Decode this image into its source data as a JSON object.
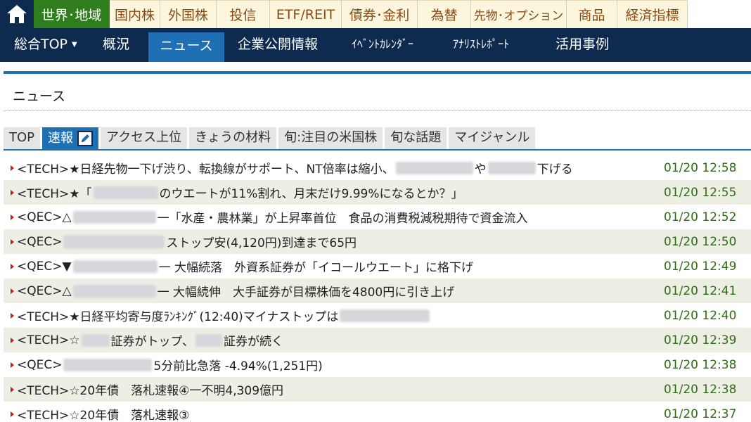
{
  "top_nav": {
    "home_icon": "home-icon",
    "items": [
      {
        "label": "世界･地域",
        "active": true
      },
      {
        "label": "国内株"
      },
      {
        "label": "外国株"
      },
      {
        "label": "投信"
      },
      {
        "label": "ETF/REIT"
      },
      {
        "label": "債券･金利"
      },
      {
        "label": "為替"
      },
      {
        "label": "先物･オプション"
      },
      {
        "label": "商品"
      },
      {
        "label": "経済指標"
      }
    ]
  },
  "sub_nav": {
    "items": [
      {
        "label": "総合TOP",
        "dropdown": true
      },
      {
        "label": "概況"
      },
      {
        "label": "ニュース",
        "active": true
      },
      {
        "label": "企業公開情報"
      },
      {
        "label": "ｲﾍﾞﾝﾄｶﾚﾝﾀﾞｰ"
      },
      {
        "label": "ｱﾅﾘｽﾄﾚﾎﾟｰﾄ"
      },
      {
        "label": "活用事例"
      }
    ]
  },
  "page_title": "ニュース",
  "tabs": [
    {
      "label": "TOP"
    },
    {
      "label": "速報",
      "active": true,
      "icon": "pencil-icon"
    },
    {
      "label": "アクセス上位"
    },
    {
      "label": "きょうの材料"
    },
    {
      "label": "旬:注目の米国株"
    },
    {
      "label": "旬な話題"
    },
    {
      "label": "マイジャンル"
    }
  ],
  "news": [
    {
      "parts": [
        "<TECH>★日経先物一下げ渋り、転換線がサポート、NT倍率は縮小、",
        "",
        "や",
        "",
        "下げる"
      ],
      "time": "01/20 12:58"
    },
    {
      "parts": [
        "<TECH>★「",
        "",
        "のウエートが11%割れ、月末だけ9.99%になるとか？」"
      ],
      "time": "01/20 12:55"
    },
    {
      "parts": [
        "<QEC>△",
        "",
        "一「水産・農林業」が上昇率首位　食品の消費税減税期待で資金流入"
      ],
      "time": "01/20 12:52"
    },
    {
      "parts": [
        "<QEC>",
        "",
        " ストップ安(4,120円)到達まで65円"
      ],
      "time": "01/20 12:50"
    },
    {
      "parts": [
        "<QEC>▼",
        "",
        "一 大幅続落　外資系証券が「イコールウエート」に格下げ"
      ],
      "time": "01/20 12:49"
    },
    {
      "parts": [
        "<QEC>△",
        "",
        "一 大幅続伸　大手証券が目標株価を4800円に引き上げ"
      ],
      "time": "01/20 12:41"
    },
    {
      "parts": [
        "<TECH>★日経平均寄与度ﾗﾝｷﾝｸﾞ(12:40)マイナストップは",
        ""
      ],
      "time": "01/20 12:40"
    },
    {
      "parts": [
        "<TECH>☆",
        "",
        "証券がトップ、",
        "",
        "証券が続く"
      ],
      "time": "01/20 12:39"
    },
    {
      "parts": [
        "<QEC>",
        "",
        " 5分前比急落 -4.94%(1,251円)"
      ],
      "time": "01/20 12:38"
    },
    {
      "parts": [
        "<TECH>☆20年債　落札速報④一不明4,309億円"
      ],
      "time": "01/20 12:38"
    },
    {
      "parts": [
        "<TECH>☆20年債　落札速報③"
      ],
      "time": "01/20 12:37"
    }
  ]
}
